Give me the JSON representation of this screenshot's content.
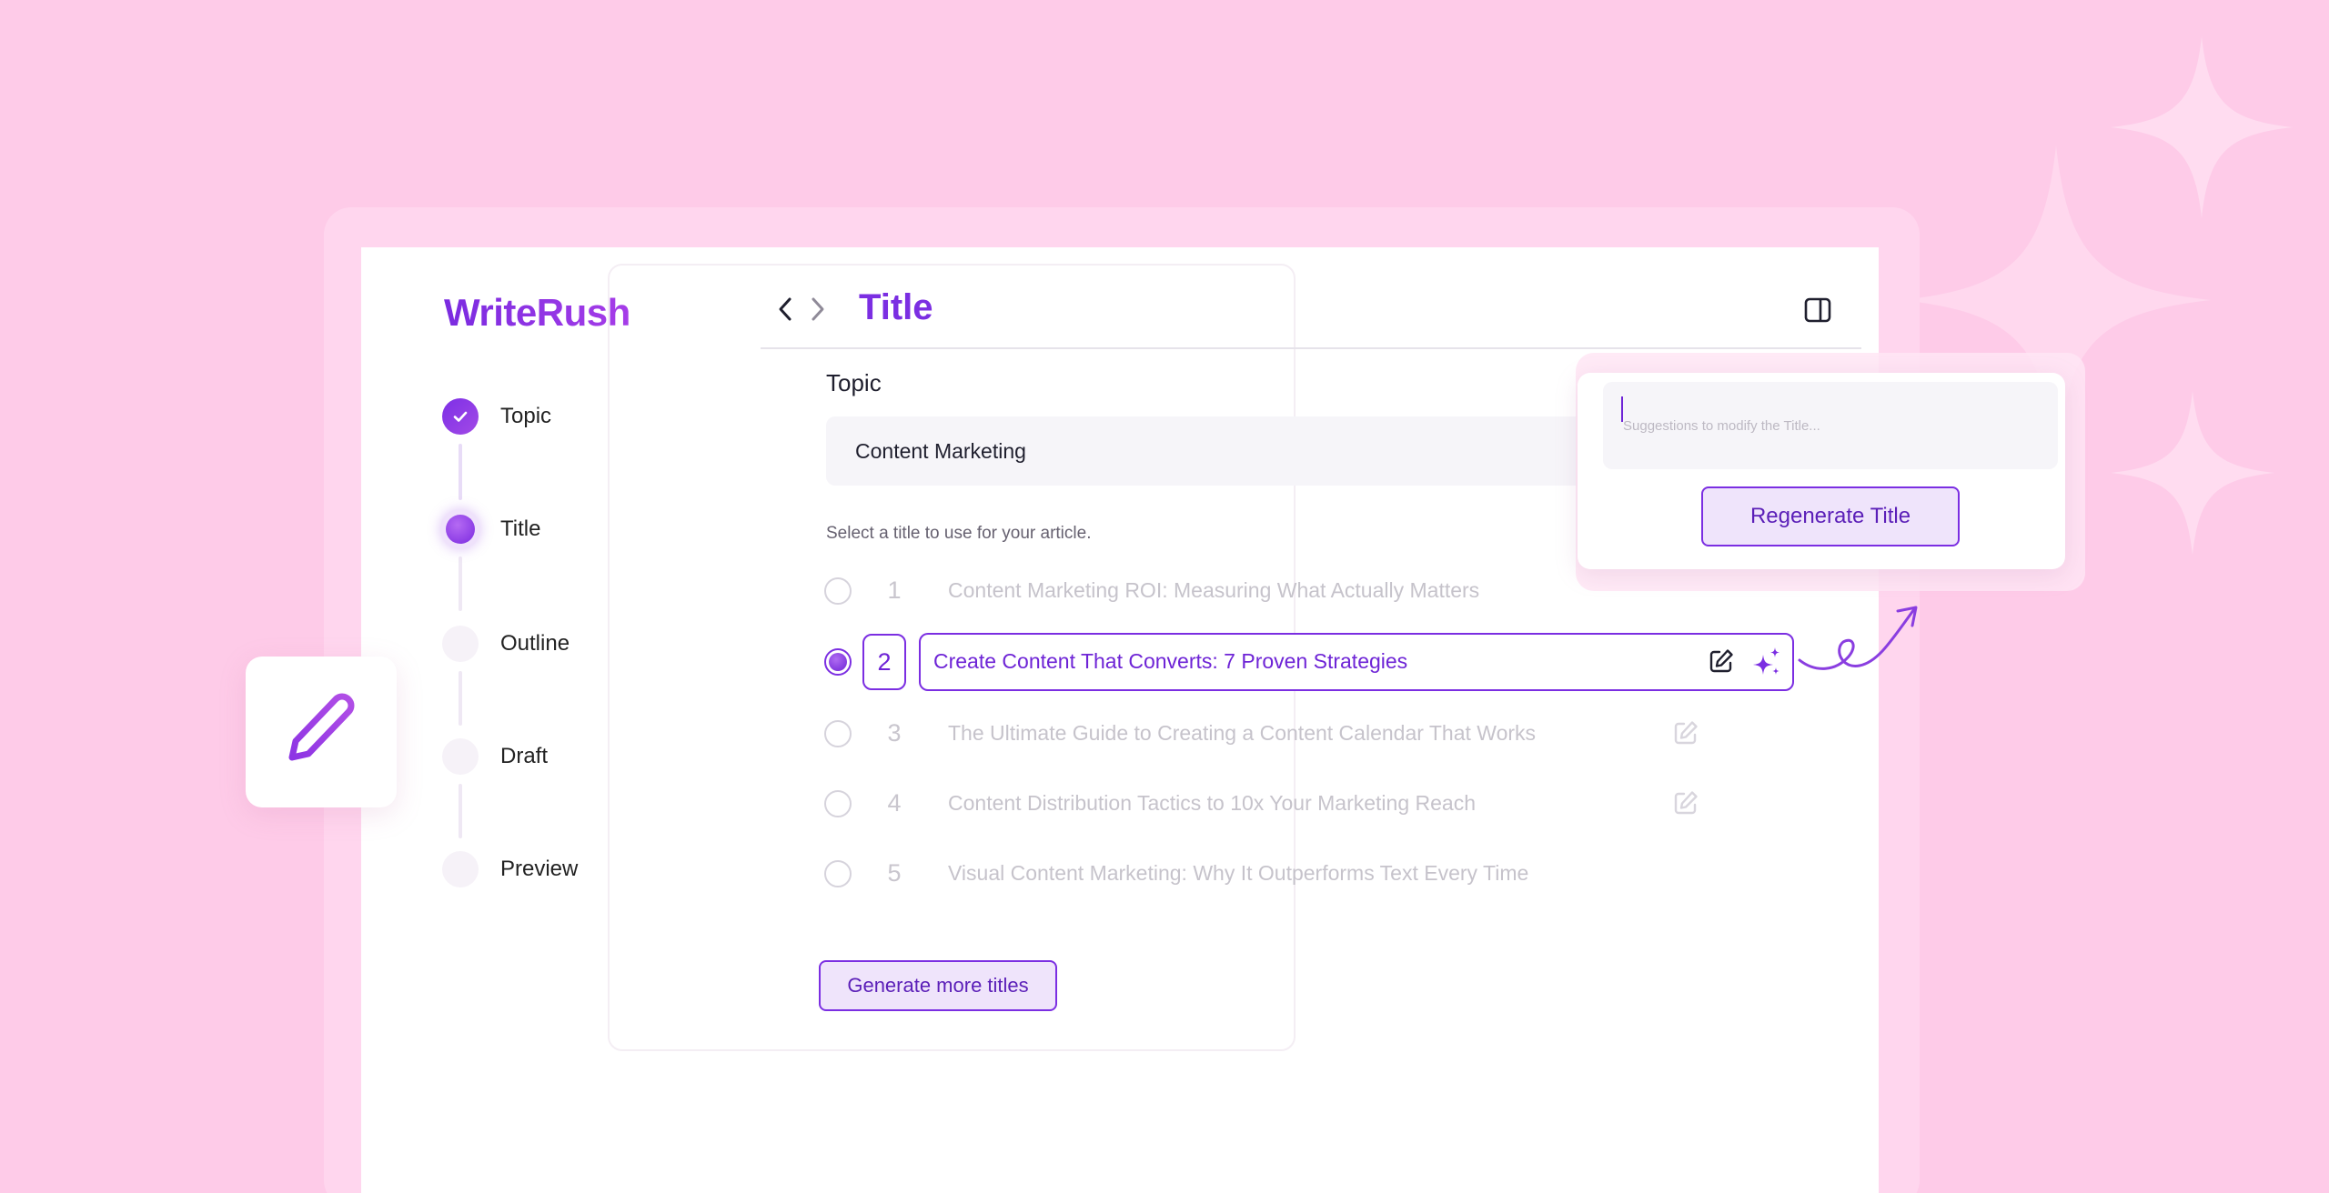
{
  "app": {
    "logo": "WriteRush"
  },
  "stepper": {
    "steps": [
      {
        "label": "Topic",
        "state": "done"
      },
      {
        "label": "Title",
        "state": "active"
      },
      {
        "label": "Outline",
        "state": "pending"
      },
      {
        "label": "Draft",
        "state": "pending"
      },
      {
        "label": "Preview",
        "state": "pending"
      }
    ]
  },
  "header": {
    "title": "Title"
  },
  "topic": {
    "label": "Topic",
    "value": "Content Marketing"
  },
  "helper_text": "Select a title to use for your article.",
  "titles": [
    {
      "number": "1",
      "text": "Content Marketing ROI: Measuring What Actually Matters",
      "selected": false
    },
    {
      "number": "2",
      "text": "Create Content That Converts: 7 Proven Strategies",
      "selected": true
    },
    {
      "number": "3",
      "text": "The Ultimate Guide to Creating a Content Calendar That Works",
      "selected": false
    },
    {
      "number": "4",
      "text": "Content Distribution Tactics to 10x Your Marketing Reach",
      "selected": false
    },
    {
      "number": "5",
      "text": "Visual Content Marketing: Why It Outperforms Text Every Time",
      "selected": false
    }
  ],
  "generate_more_label": "Generate more titles",
  "regenerate": {
    "placeholder": "Suggestions to modify the Title...",
    "button_label": "Regenerate Title"
  },
  "colors": {
    "background": "#fecbe8",
    "accent": "#7b2ee2",
    "accent_light": "#efe4fb"
  },
  "icons": [
    "check-icon",
    "chevron-left-icon",
    "chevron-right-icon",
    "sidebar-toggle-icon",
    "edit-icon",
    "sparkles-icon",
    "pen-icon",
    "swirl-arrow-icon"
  ]
}
